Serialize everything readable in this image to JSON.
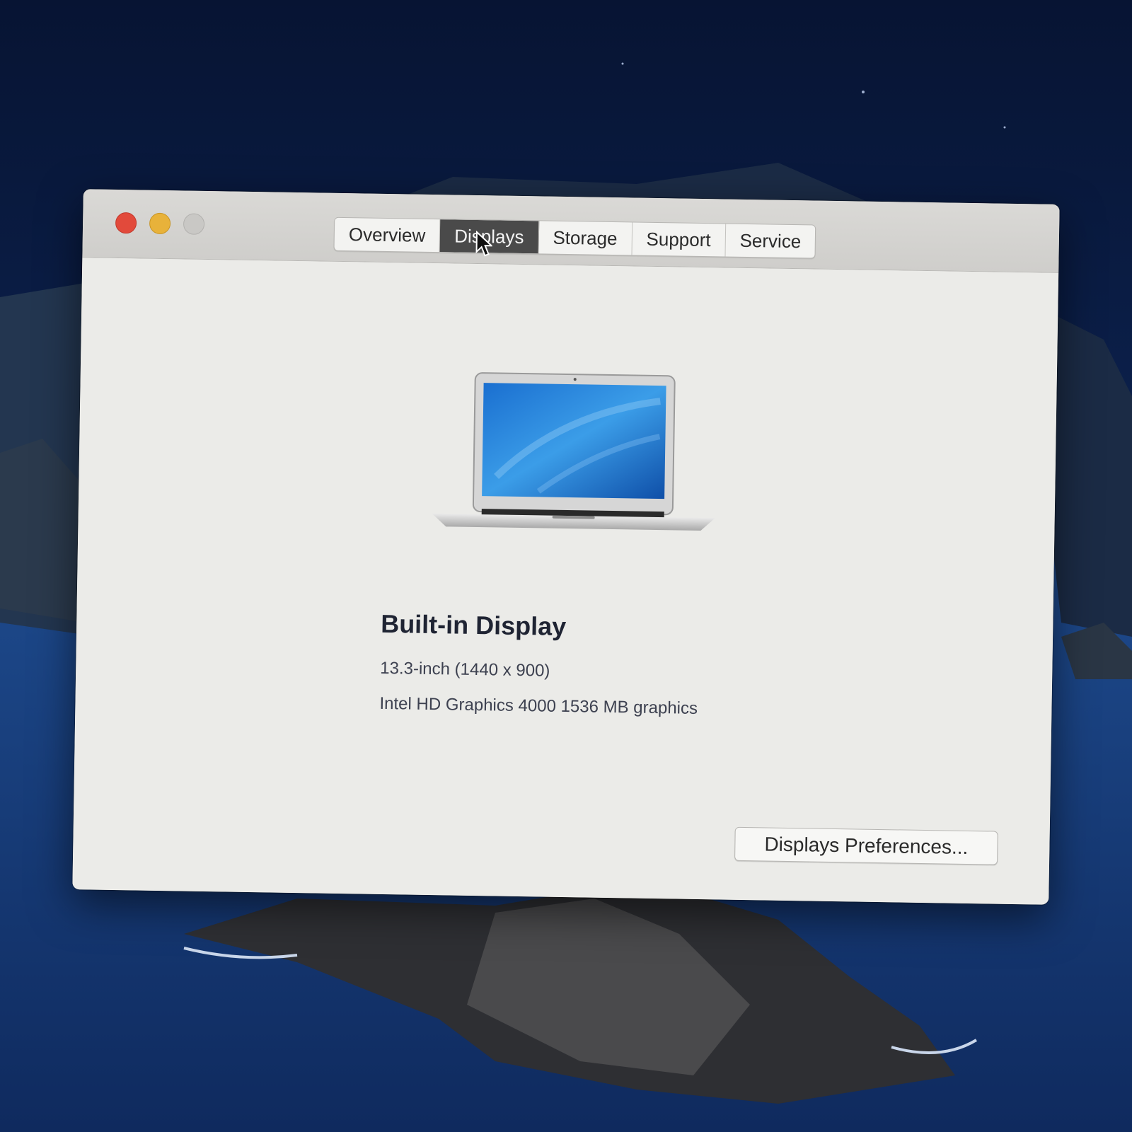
{
  "window": {
    "controls": [
      "close",
      "minimize",
      "zoom"
    ],
    "tabs": [
      {
        "label": "Overview",
        "active": false
      },
      {
        "label": "Displays",
        "active": true
      },
      {
        "label": "Storage",
        "active": false
      },
      {
        "label": "Support",
        "active": false
      },
      {
        "label": "Service",
        "active": false
      }
    ]
  },
  "display": {
    "title": "Built-in Display",
    "size": "13.3-inch (1440 x 900)",
    "graphics": "Intel HD Graphics 4000 1536 MB graphics",
    "icon": "laptop-icon"
  },
  "buttons": {
    "preferences": "Displays Preferences..."
  },
  "colors": {
    "close": "#e24a3b",
    "minimize": "#e8b23a",
    "zoom": "#c9c8c5",
    "active_tab": "#4a4a4a"
  }
}
